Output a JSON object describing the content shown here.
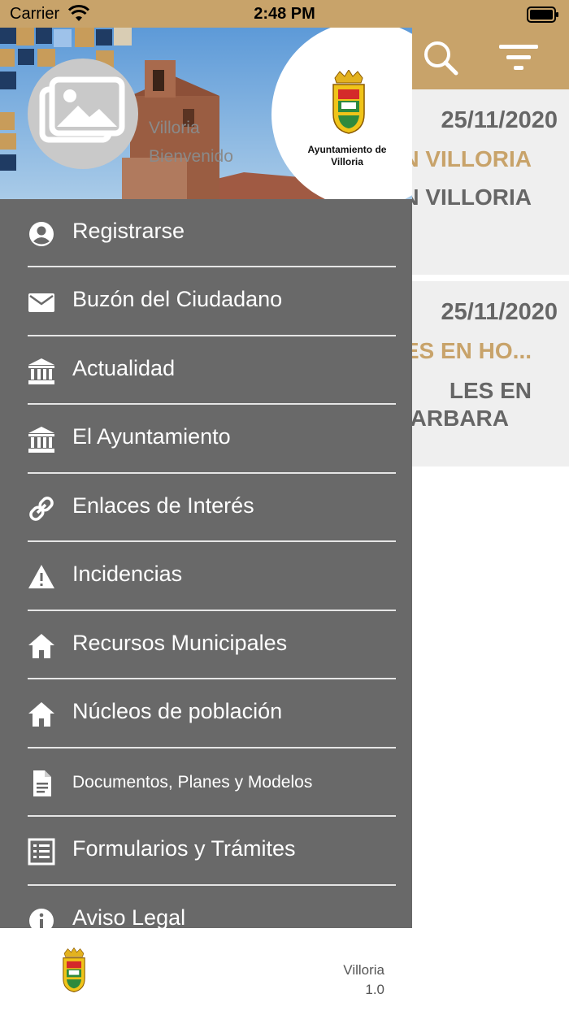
{
  "status_bar": {
    "carrier": "Carrier",
    "time": "2:48 PM"
  },
  "colors": {
    "accent": "#c8a36a",
    "drawer": "#696969",
    "card": "#efefef",
    "muted": "#666666"
  },
  "background_news": [
    {
      "date": "25/11/2020",
      "title": "N VILLORIA",
      "subtitle": "N VILLORIA"
    },
    {
      "date": "25/11/2020",
      "title": "LES EN HO...",
      "subtitle_lines": [
        "LES EN",
        "ARBARA"
      ]
    }
  ],
  "drawer": {
    "header": {
      "name": "Villoria",
      "welcome": "Bienvenido",
      "badge_line1": "Ayuntamiento de",
      "badge_line2": "Villoria"
    },
    "items": [
      {
        "label": "Registrarse",
        "icon": "account-circle-icon"
      },
      {
        "label": "Buzón del Ciudadano",
        "icon": "mail-icon"
      },
      {
        "label": "Actualidad",
        "icon": "bank-icon"
      },
      {
        "label": "El Ayuntamiento",
        "icon": "bank-icon"
      },
      {
        "label": "Enlaces de Interés",
        "icon": "link-icon"
      },
      {
        "label": "Incidencias",
        "icon": "warning-icon"
      },
      {
        "label": "Recursos Municipales",
        "icon": "home-icon"
      },
      {
        "label": "Núcleos de población",
        "icon": "home-icon"
      },
      {
        "label": "Documentos, Planes y Modelos",
        "icon": "document-icon"
      },
      {
        "label": "Formularios y Trámites",
        "icon": "list-icon"
      },
      {
        "label": "Aviso Legal",
        "icon": "info-icon"
      }
    ]
  },
  "footer": {
    "app_name": "Villoria",
    "version": "1.0"
  }
}
